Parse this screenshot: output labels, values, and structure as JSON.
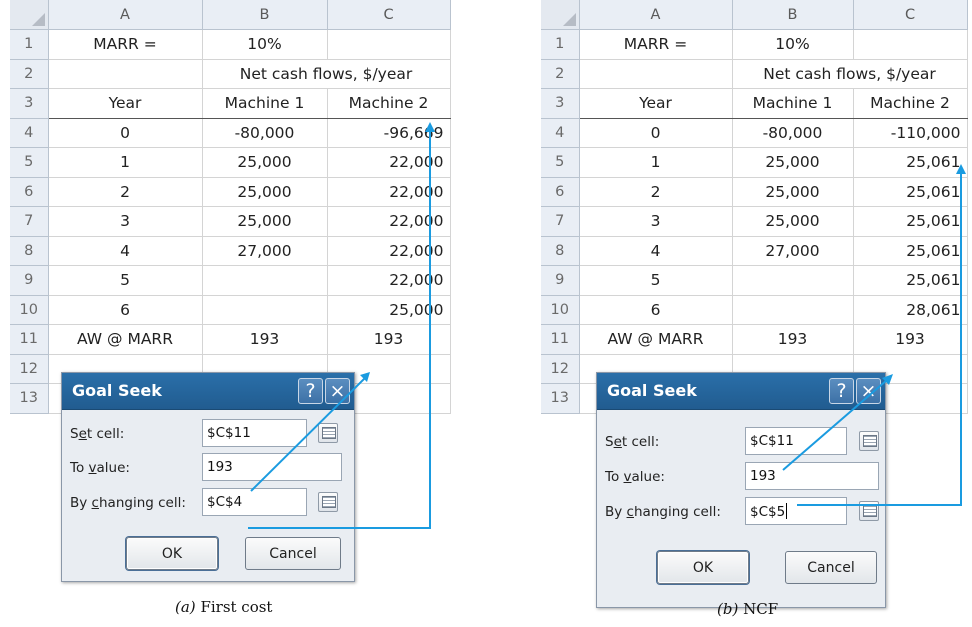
{
  "colors": {
    "arrow": "#1a9be0",
    "titlebar": "#255f96"
  },
  "icons": [
    "help-icon",
    "close-icon",
    "collapse-dialog-icon"
  ],
  "panels": [
    {
      "caption_label": "(a)",
      "caption_text": "First cost",
      "columns": [
        "A",
        "B",
        "C"
      ],
      "rows": [
        {
          "n": "1",
          "a": "MARR =",
          "b": "10%",
          "c": ""
        },
        {
          "n": "2",
          "a": "",
          "bc": "Net cash flows, $/year"
        },
        {
          "n": "3",
          "a": "Year",
          "b": "Machine 1",
          "c": "Machine 2"
        },
        {
          "n": "4",
          "a": "0",
          "b": "-80,000",
          "c": "-96,669"
        },
        {
          "n": "5",
          "a": "1",
          "b": "25,000",
          "c": "22,000"
        },
        {
          "n": "6",
          "a": "2",
          "b": "25,000",
          "c": "22,000"
        },
        {
          "n": "7",
          "a": "3",
          "b": "25,000",
          "c": "22,000"
        },
        {
          "n": "8",
          "a": "4",
          "b": "27,000",
          "c": "22,000"
        },
        {
          "n": "9",
          "a": "5",
          "b": "",
          "c": "22,000"
        },
        {
          "n": "10",
          "a": "6",
          "b": "",
          "c": "25,000"
        },
        {
          "n": "11",
          "a": "AW @ MARR",
          "b": "193",
          "c": "193"
        },
        {
          "n": "12",
          "a": "",
          "b": "",
          "c": ""
        },
        {
          "n": "13",
          "a": "",
          "b": "",
          "c": ""
        }
      ],
      "dialog": {
        "title": "Goal Seek",
        "help": "?",
        "close": "×",
        "set_cell_pre": "S",
        "set_cell_ul": "e",
        "set_cell_post": "t cell:",
        "set_cell_value": "$C$11",
        "to_value_pre": "To ",
        "to_value_ul": "v",
        "to_value_post": "alue:",
        "to_value_value": "193",
        "changing_pre": "By ",
        "changing_ul": "c",
        "changing_post": "hanging cell:",
        "changing_value": "$C$4",
        "ok": "OK",
        "cancel": "Cancel"
      }
    },
    {
      "caption_label": "(b)",
      "caption_text": "NCF",
      "columns": [
        "A",
        "B",
        "C"
      ],
      "rows": [
        {
          "n": "1",
          "a": "MARR =",
          "b": "10%",
          "c": ""
        },
        {
          "n": "2",
          "a": "",
          "bc": "Net cash flows, $/year"
        },
        {
          "n": "3",
          "a": "Year",
          "b": "Machine 1",
          "c": "Machine 2"
        },
        {
          "n": "4",
          "a": "0",
          "b": "-80,000",
          "c": "-110,000"
        },
        {
          "n": "5",
          "a": "1",
          "b": "25,000",
          "c": "25,061"
        },
        {
          "n": "6",
          "a": "2",
          "b": "25,000",
          "c": "25,061"
        },
        {
          "n": "7",
          "a": "3",
          "b": "25,000",
          "c": "25,061"
        },
        {
          "n": "8",
          "a": "4",
          "b": "27,000",
          "c": "25,061"
        },
        {
          "n": "9",
          "a": "5",
          "b": "",
          "c": "25,061"
        },
        {
          "n": "10",
          "a": "6",
          "b": "",
          "c": "28,061"
        },
        {
          "n": "11",
          "a": "AW @ MARR",
          "b": "193",
          "c": "193"
        },
        {
          "n": "12",
          "a": "",
          "b": "",
          "c": ""
        },
        {
          "n": "13",
          "a": "",
          "b": "",
          "c": ""
        }
      ],
      "dialog": {
        "title": "Goal Seek",
        "help": "?",
        "close": "×",
        "set_cell_pre": "S",
        "set_cell_ul": "e",
        "set_cell_post": "t cell:",
        "set_cell_value": "$C$11",
        "to_value_pre": "To ",
        "to_value_ul": "v",
        "to_value_post": "alue:",
        "to_value_value": "193",
        "changing_pre": "By ",
        "changing_ul": "c",
        "changing_post": "hanging cell:",
        "changing_value": "$C$5",
        "ok": "OK",
        "cancel": "Cancel"
      }
    }
  ]
}
